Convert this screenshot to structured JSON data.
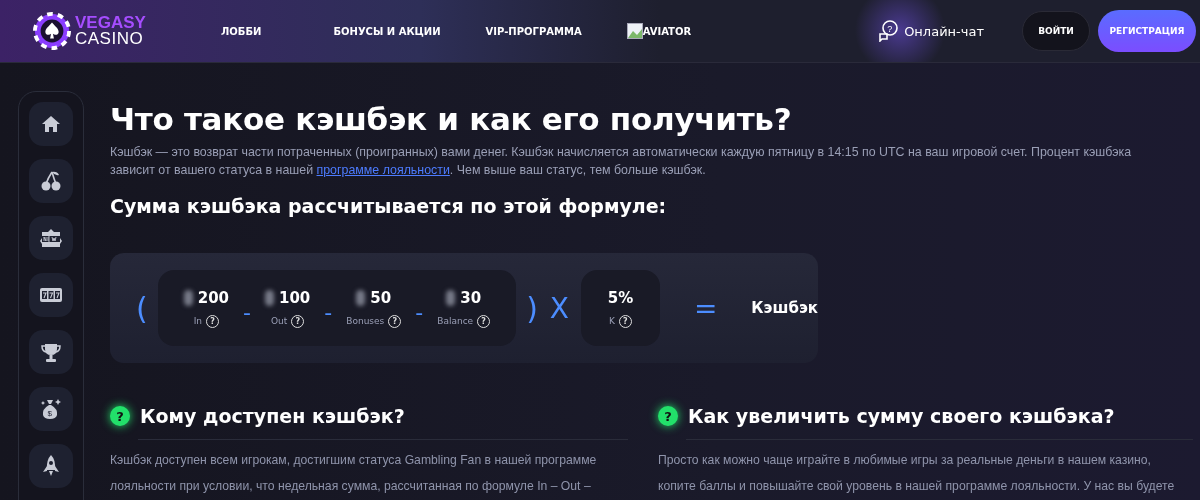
{
  "header": {
    "logo": {
      "top": "VEGASY",
      "bottom": "CASINO"
    },
    "nav": [
      {
        "label": "ЛОББИ",
        "kind": "text"
      },
      {
        "label": "БОНУСЫ И АКЦИИ",
        "kind": "text"
      },
      {
        "label": "VIP-ПРОГРАММА",
        "kind": "text"
      },
      {
        "label": "AVIATOR",
        "kind": "broken-image"
      }
    ],
    "chat_icon_mark": "?",
    "chat": "Онлайн-чат",
    "login": "ВОЙТИ",
    "register": "РЕГИСТРАЦИЯ"
  },
  "sidebar": {
    "items": [
      {
        "kind": "home"
      },
      {
        "kind": "cherry"
      },
      {
        "kind": "new"
      },
      {
        "kind": "slots"
      },
      {
        "kind": "trophy"
      },
      {
        "kind": "moneybag",
        "mark": "$"
      },
      {
        "kind": "rocket"
      }
    ]
  },
  "article": {
    "title": "Что такое кэшбэк и как его получить?",
    "intro": {
      "first_line": "Кэшбэк — это возврат части потраченных (проигранных) вами денег. Кэшбэк начисляется автоматически каждую пятницу в 14:15 по UTC на ваш игровой счет. Процент кэшбэка",
      "before_link": "зависит от вашего статуса в нашей ",
      "link": "программе лояльности",
      "after_link": ". Чем выше ваш статус, тем больше кэшбэк."
    },
    "formula_heading": "Сумма кэшбэка рассчитывается по этой формуле:",
    "formula": {
      "open": "(",
      "terms": [
        {
          "value": "200",
          "label": "In"
        },
        {
          "value": "100",
          "label": "Out"
        },
        {
          "value": "50",
          "label": "Bonuses"
        },
        {
          "value": "30",
          "label": "Balance"
        }
      ],
      "help_mark": "?",
      "operators": [
        "-",
        "-",
        "-"
      ],
      "close": ")",
      "times": "X",
      "factor": {
        "value": "5%",
        "label": "K"
      },
      "equals": "=",
      "result": "Кэшбэк"
    },
    "sections": [
      {
        "mark": "?",
        "heading": "Кому доступен кэшбэк?",
        "lines": [
          "Кэшбэк доступен всем игрокам, достигшим статуса Gambling Fan в нашей программе",
          "лояльности при условии, что недельная сумма, рассчитанная по формуле In – Out –"
        ]
      },
      {
        "mark": "?",
        "heading": "Как увеличить сумму своего кэшбэка?",
        "lines": [
          "Просто как можно чаще играйте в любимые игры за реальные деньги в нашем казино,",
          "копите баллы и повышайте свой уровень в нашей программе лояльности. У нас вы будете"
        ]
      }
    ]
  }
}
